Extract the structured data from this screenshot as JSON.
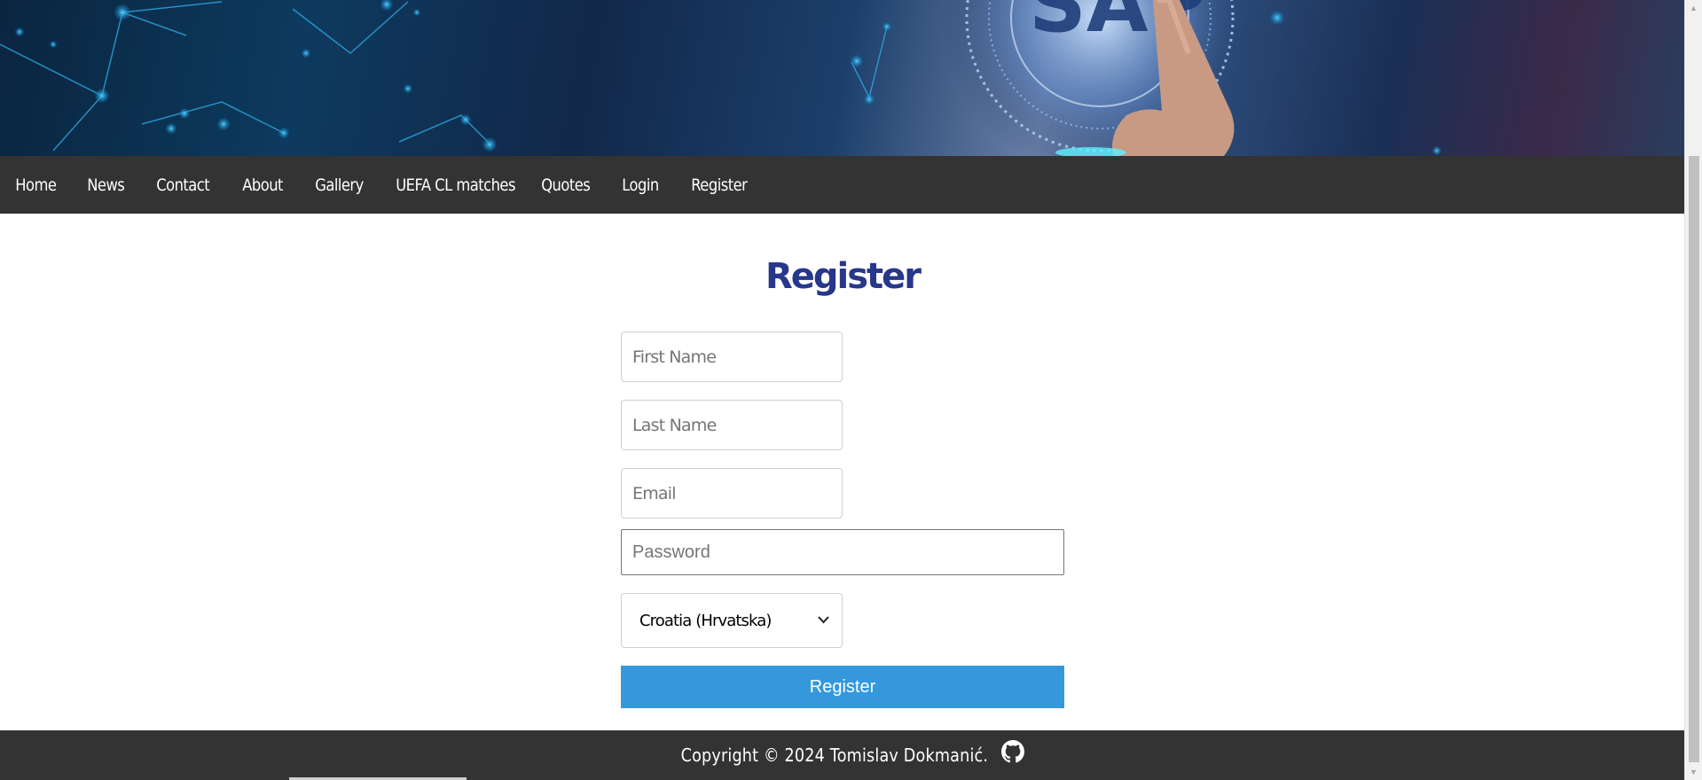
{
  "nav": {
    "items": [
      {
        "label": "Home"
      },
      {
        "label": "News"
      },
      {
        "label": "Contact"
      },
      {
        "label": "About"
      },
      {
        "label": "Gallery"
      },
      {
        "label": "UEFA CL matches"
      },
      {
        "label": "Quotes"
      },
      {
        "label": "Login"
      },
      {
        "label": "Register"
      }
    ]
  },
  "banner": {
    "text": "SAP"
  },
  "form": {
    "title": "Register",
    "first_name_placeholder": "First Name",
    "last_name_placeholder": "Last Name",
    "email_placeholder": "Email",
    "password_placeholder": "Password",
    "country_selected": "Croatia (Hrvatska)",
    "submit_label": "Register"
  },
  "footer": {
    "text": "Copyright © 2024 Tomislav Dokmanić."
  },
  "colors": {
    "navbar_bg": "#333333",
    "title": "#27378a",
    "button": "#3498db"
  },
  "icons": {
    "github": "github-icon",
    "select_chevron": "chevron-down-icon"
  }
}
